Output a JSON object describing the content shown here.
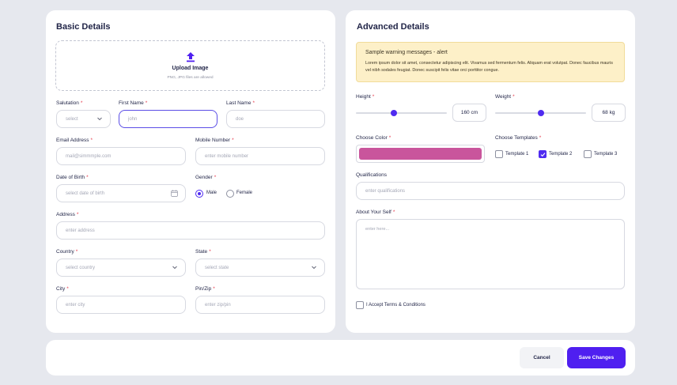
{
  "basic": {
    "title": "Basic Details",
    "upload": {
      "title": "Upload Image",
      "sub": "PNG, JPG files are allowed"
    },
    "salutation": {
      "label": "Salutation",
      "placeholder": "select"
    },
    "first_name": {
      "label": "First Name",
      "placeholder": "john"
    },
    "last_name": {
      "label": "Last Name",
      "placeholder": "doe"
    },
    "email": {
      "label": "Email Address",
      "placeholder": "mail@simmmple.com"
    },
    "mobile": {
      "label": "Mobile Number",
      "placeholder": "enter mobile number"
    },
    "dob": {
      "label": "Date of Birth",
      "placeholder": "select date of birth"
    },
    "gender": {
      "label": "Gender",
      "options": [
        "Male",
        "Female"
      ],
      "selected": "Male"
    },
    "address": {
      "label": "Address",
      "placeholder": "enter address"
    },
    "country": {
      "label": "Country",
      "placeholder": "select country"
    },
    "state": {
      "label": "State",
      "placeholder": "select state"
    },
    "city": {
      "label": "City",
      "placeholder": "enter city"
    },
    "pin": {
      "label": "Pin/Zip",
      "placeholder": "enter zip/pin"
    },
    "required_mark": "*"
  },
  "advanced": {
    "title": "Advanced Details",
    "alert": {
      "title": "Sample warning messages - alert",
      "body": "Lorem ipsum dolor sit amet, consectetur adipiscing elit. Vivamus sed fermentum felis. Aliquam erat volutpat. Donec faucibus mauris vel nibh sodales feugiat. Donec suscipit felis vitae orci porttitor congue."
    },
    "height": {
      "label": "Height",
      "value": "160 cm",
      "level": 0.42
    },
    "weight": {
      "label": "Weight",
      "value": "68 kg",
      "level": 0.5
    },
    "color": {
      "label": "Choose Color",
      "value": "#c9559c"
    },
    "templates": {
      "label": "Choose Templates",
      "items": [
        "Template 1",
        "Template 2",
        "Template 3"
      ],
      "checked": "Template 2"
    },
    "qualifications": {
      "label": "Qualifications",
      "placeholder": "enter qualifications"
    },
    "about": {
      "label": "About Your Self",
      "placeholder": "enter here..."
    },
    "terms": {
      "label": "I Accept Terms & Conditions"
    }
  },
  "footer": {
    "cancel": "Cancel",
    "save": "Save Changes"
  },
  "colors": {
    "accent": "#4f1ff0",
    "warning_bg": "#fdf0c8",
    "required": "#e5394b"
  }
}
